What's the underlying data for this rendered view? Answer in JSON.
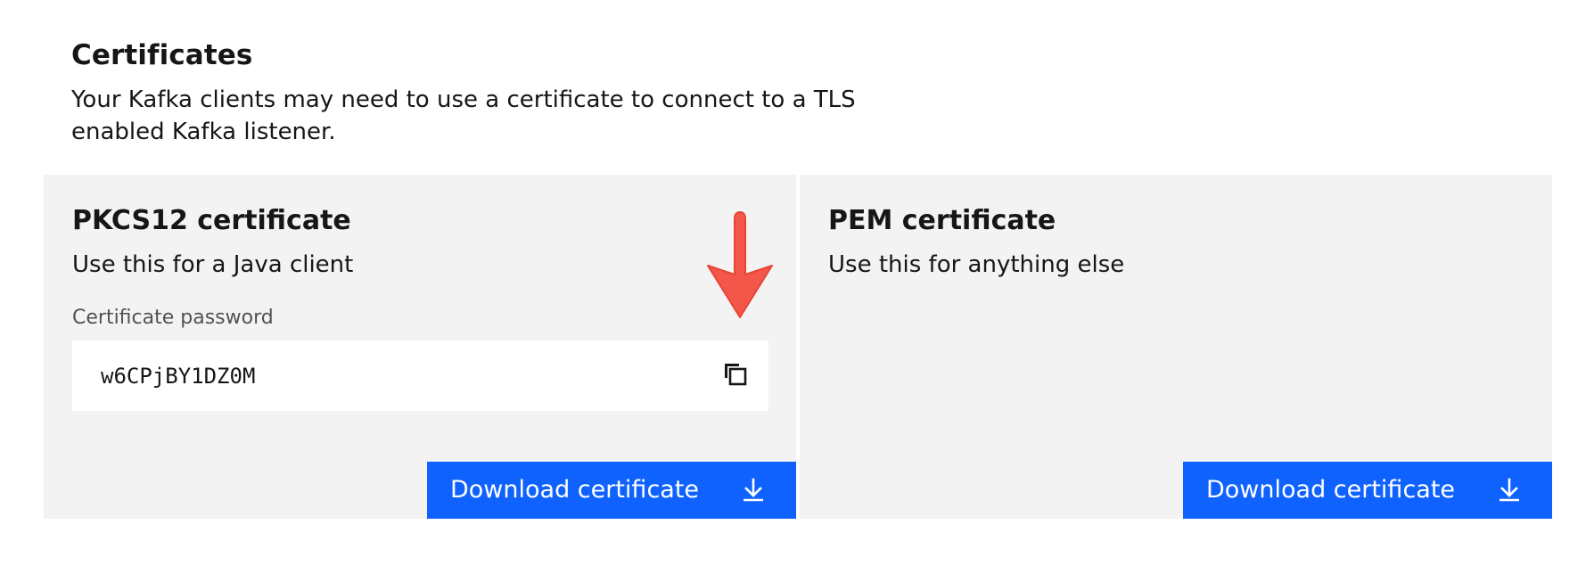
{
  "certificates": {
    "title": "Certificates",
    "description": "Your Kafka clients may need to use a certificate to connect to a TLS enabled Kafka listener."
  },
  "pkcs12": {
    "title": "PKCS12 certificate",
    "description": "Use this for a Java client",
    "password_label": "Certificate password",
    "password_value": "w6CPjBY1DZ0M",
    "copy_icon": "copy-icon",
    "download_label": "Download certificate",
    "download_icon": "download-icon"
  },
  "pem": {
    "title": "PEM certificate",
    "description": "Use this for anything else",
    "download_label": "Download certificate",
    "download_icon": "download-icon"
  },
  "colors": {
    "button_primary": "#0f62fe",
    "tile_background": "#f3f3f3",
    "field_background": "#ffffff",
    "annotation_arrow": "#f4564a"
  }
}
